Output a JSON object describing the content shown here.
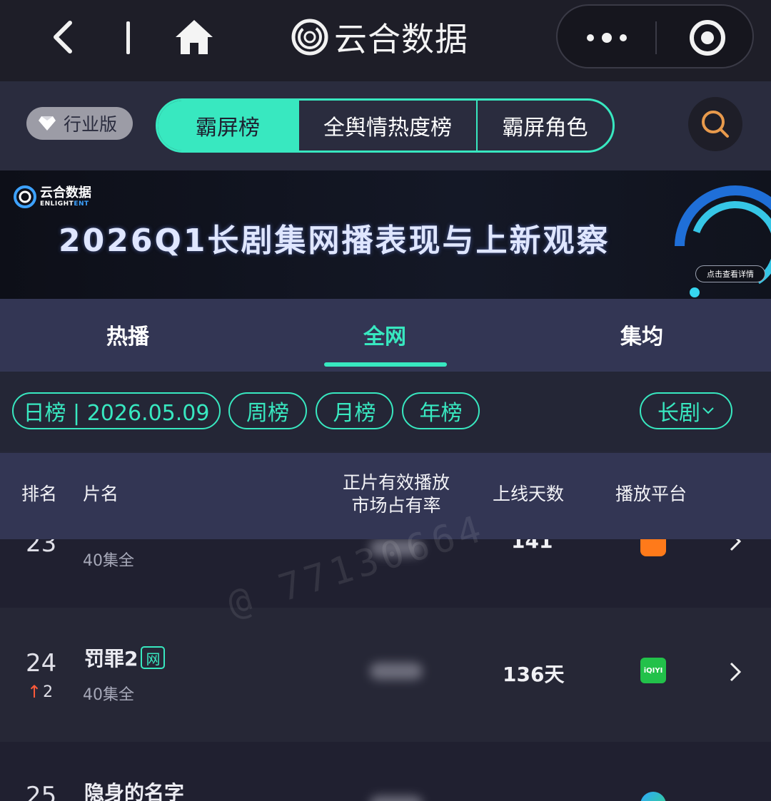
{
  "topbar": {
    "app_title": "云合数据",
    "icons": [
      "back-icon",
      "home-icon",
      "more-icon",
      "target-icon"
    ]
  },
  "nav": {
    "edition_label": "行业版",
    "tabs": [
      {
        "label": "霸屏榜",
        "active": true
      },
      {
        "label": "全舆情热度榜",
        "active": false
      },
      {
        "label": "霸屏角色",
        "active": false
      }
    ]
  },
  "banner": {
    "logo_cn": "云合数据",
    "logo_en_1": "ENLIGHT",
    "logo_en_2": "ENT",
    "title": "2026Q1长剧集网播表现与上新观察",
    "cta": "点击查看详情"
  },
  "subtabs": [
    {
      "label": "热播",
      "active": false
    },
    {
      "label": "全网",
      "active": true
    },
    {
      "label": "集均",
      "active": false
    }
  ],
  "filters": {
    "daily": "日榜 | 2026.05.09",
    "weekly": "周榜",
    "monthly": "月榜",
    "yearly": "年榜",
    "category": "长剧"
  },
  "table": {
    "headers": {
      "rank": "排名",
      "name": "片名",
      "share_line1": "正片有效播放",
      "share_line2": "市场占有率",
      "days": "上线天数",
      "platform": "播放平台"
    },
    "rows": [
      {
        "rank": "23",
        "title": "",
        "episodes": "40集全",
        "days": "141",
        "platform": "mgtv"
      },
      {
        "rank": "24",
        "change": "2",
        "title": "罚罪2",
        "badge": "网",
        "episodes": "40集全",
        "days": "136天",
        "platform": "iQIYI"
      },
      {
        "rank": "25",
        "title": "隐身的名字",
        "episodes": "",
        "days": "",
        "platform": "tencent"
      }
    ]
  },
  "watermark": "@ 77130664",
  "colors": {
    "accent": "#38e8c0",
    "background": "#1e1e2c",
    "header_bg": "#333654",
    "up_arrow": "#ff5b3a"
  }
}
